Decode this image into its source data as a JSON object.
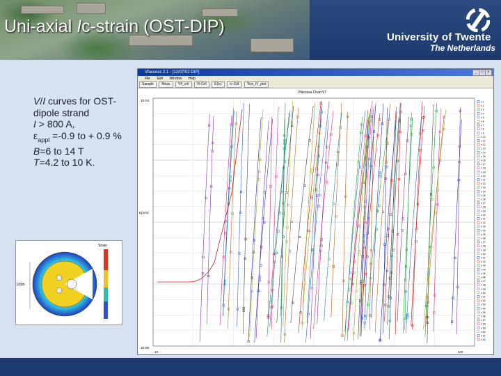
{
  "slide": {
    "title_prefix": "Uni-axial ",
    "title_italic": "I",
    "title_suffix": "c-strain (OST-DIP)",
    "university": "University of Twente",
    "country": "The Netherlands",
    "desc_line1_italic": "V",
    "desc_line1_slash": "/",
    "desc_line1_italic2": "I",
    "desc_line1_rest": " curves for OST-",
    "desc_line2": "dipole strand",
    "desc_line3_italic": "I",
    "desc_line3_rest": " > 800 A,",
    "desc_line4_eps": "ε",
    "desc_line4_sub": "appl",
    "desc_line4_rest": " =-0.9 to + 0.9 %",
    "desc_line5_italic": "B",
    "desc_line5_rest": "=6 to 14 T",
    "desc_line6_italic": "T",
    "desc_line6_rest": "=4.2 to 10 K."
  },
  "inset": {
    "legend_title": "Strain",
    "left_label": "120th"
  },
  "app": {
    "window_title": "Vfaccess 2.1 - [12/07/02 DIP]",
    "menu": [
      "File",
      "Edit",
      "Window",
      "Help"
    ],
    "tabs": [
      "Sample",
      "Meas",
      "V4_crit",
      "Vi-Crit",
      "E(Ic)",
      "Ic-Crit",
      "Test_IV_plot"
    ],
    "plot_title": "Vfaccess Chart 97",
    "y_top_label": "1E-04",
    "y_mid_label": "E[V/m]",
    "y_bottom_label": "1E-06",
    "x_left_label": "10",
    "x_right_label": "100",
    "legend_prefix": "v"
  }
}
